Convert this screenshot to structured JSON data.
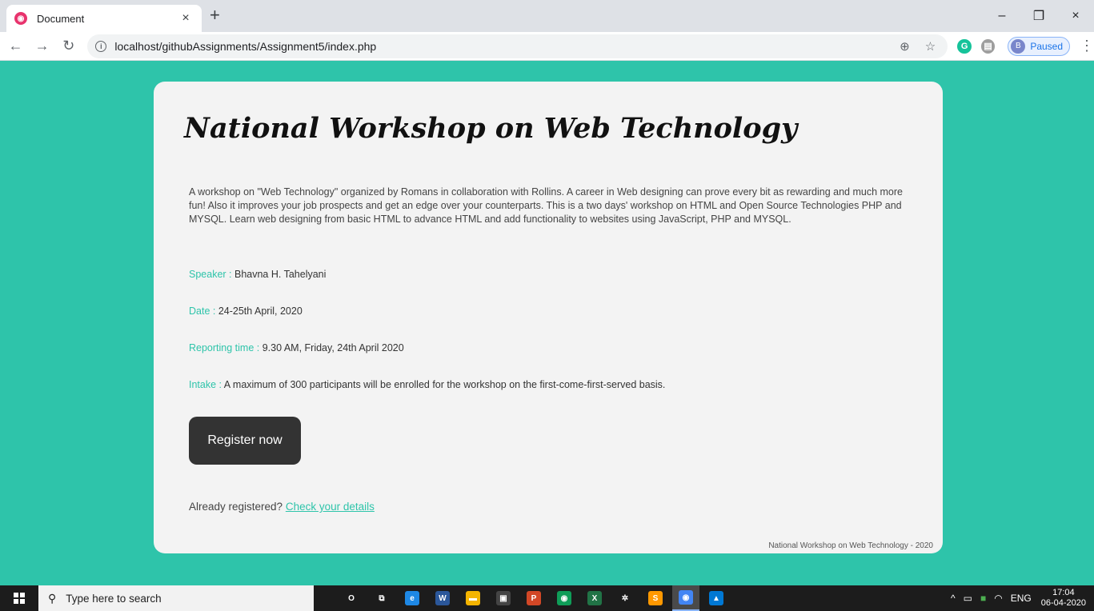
{
  "browser": {
    "tab_title": "Document",
    "tab_close": "×",
    "new_tab": "+",
    "url": "localhost/githubAssignments/Assignment5/index.php",
    "profile_initial": "B",
    "profile_status": "Paused",
    "win_minimize": "–",
    "win_restore": "❐",
    "win_close": "×"
  },
  "page": {
    "title": "National Workshop on Web Technology",
    "intro": "A workshop on \"Web Technology\" organized by Romans in collaboration with Rollins. A career in Web designing can prove every bit as rewarding and much more fun! Also it improves your job prospects and get an edge over your counterparts. This is a two days' workshop on HTML and Open Source Technologies PHP and MYSQL. Learn web designing from basic HTML to advance HTML and add functionality to websites using JavaScript, PHP and MYSQL.",
    "details": [
      {
        "label": "Speaker : ",
        "value": "Bhavna H. Tahelyani"
      },
      {
        "label": "Date : ",
        "value": "24-25th April, 2020"
      },
      {
        "label": "Reporting time : ",
        "value": "9.30 AM, Friday, 24th April 2020"
      },
      {
        "label": "Intake : ",
        "value": "A maximum of 300 participants will be enrolled for the workshop on the first-come-first-served basis."
      }
    ],
    "register_label": "Register now",
    "already_text": "Already registered? ",
    "check_link": "Check your details",
    "footer": "National Workshop on Web Technology - 2020"
  },
  "taskbar": {
    "search_placeholder": "Type here to search",
    "language": "ENG",
    "time": "17:04",
    "date": "06-04-2020",
    "apps": [
      {
        "name": "cortana-icon",
        "glyph": "O",
        "color": "transparent"
      },
      {
        "name": "task-view-icon",
        "glyph": "⧉",
        "color": "transparent"
      },
      {
        "name": "edge-icon",
        "glyph": "e",
        "color": "#1e88e5"
      },
      {
        "name": "word-icon",
        "glyph": "W",
        "color": "#2b579a"
      },
      {
        "name": "file-explorer-icon",
        "glyph": "▬",
        "color": "#f4b400"
      },
      {
        "name": "store-icon",
        "glyph": "▣",
        "color": "#444444"
      },
      {
        "name": "powerpoint-icon",
        "glyph": "P",
        "color": "#d24726"
      },
      {
        "name": "chrome-icon",
        "glyph": "◉",
        "color": "#0f9d58"
      },
      {
        "name": "excel-icon",
        "glyph": "X",
        "color": "#217346"
      },
      {
        "name": "settings-icon",
        "glyph": "✲",
        "color": "transparent"
      },
      {
        "name": "sublime-icon",
        "glyph": "S",
        "color": "#ff9800"
      },
      {
        "name": "chrome-profile-icon",
        "glyph": "◉",
        "color": "#4285f4"
      },
      {
        "name": "photos-icon",
        "glyph": "▲",
        "color": "#0078d4"
      }
    ]
  },
  "colors": {
    "background": "#2ec4aa",
    "accent": "#2ec4aa",
    "button": "#333333"
  }
}
